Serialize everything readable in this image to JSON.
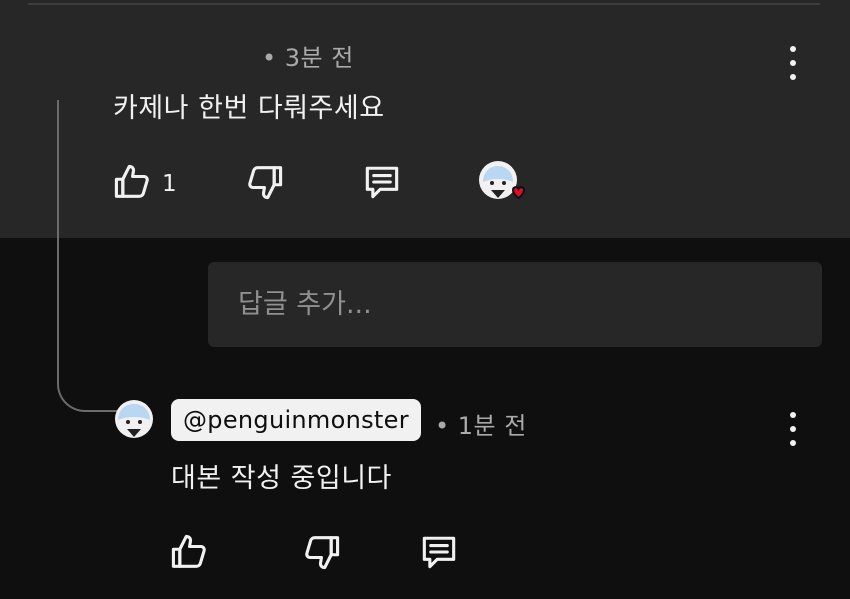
{
  "parent_comment": {
    "timestamp": "• 3분 전",
    "text": "카제나 한번 다뤄주세요",
    "like_count": "1",
    "actions": {
      "like_icon": "thumbs-up-icon",
      "dislike_icon": "thumbs-down-icon",
      "reply_icon": "reply-icon",
      "creator_heart": "creator-heart-icon"
    }
  },
  "reply_input": {
    "placeholder": "답글 추가..."
  },
  "reply_comment": {
    "author_handle": "@penguinmonster",
    "timestamp": "• 1분 전",
    "text": "대본 작성 중입니다"
  },
  "colors": {
    "background": "#0f0f0f",
    "highlight": "#272727",
    "heart": "#e00c2b",
    "avatar": "#b9d6f2"
  }
}
